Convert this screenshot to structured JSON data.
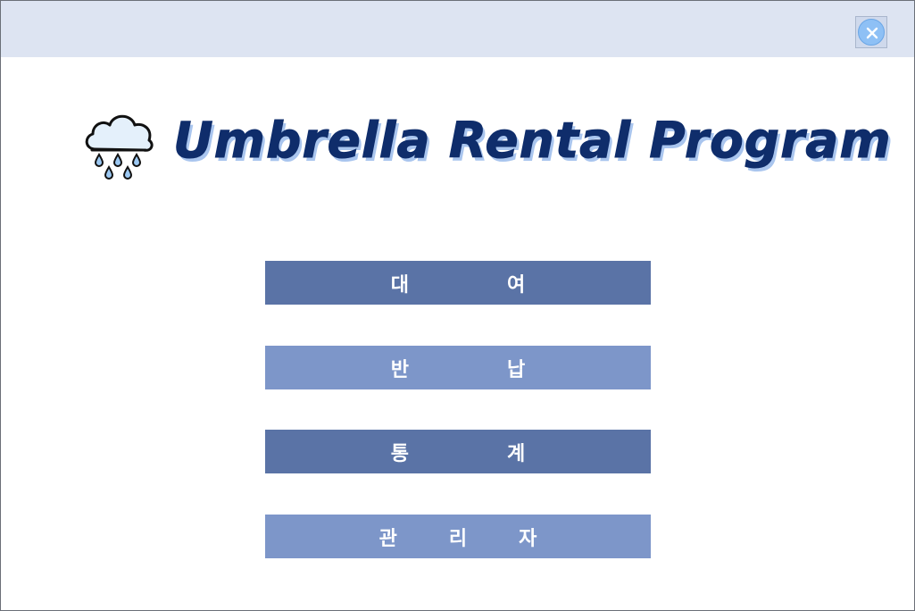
{
  "window": {
    "close_icon": "close-icon",
    "accent_color": "#8ec0f5",
    "titlebar_color": "#dde4f2"
  },
  "header": {
    "logo_icon": "rain-cloud-icon",
    "title": "Umbrella Rental Program",
    "title_color": "#0f2d6b",
    "title_shadow_color": "#a9c5ee"
  },
  "menu": {
    "rent": {
      "chars": [
        "대",
        "여"
      ],
      "color": "#5a73a6"
    },
    "return": {
      "chars": [
        "반",
        "납"
      ],
      "color": "#7d96c9"
    },
    "stats": {
      "chars": [
        "통",
        "계"
      ],
      "color": "#5a73a6"
    },
    "admin": {
      "chars": [
        "관",
        "리",
        "자"
      ],
      "color": "#7d96c9"
    }
  }
}
